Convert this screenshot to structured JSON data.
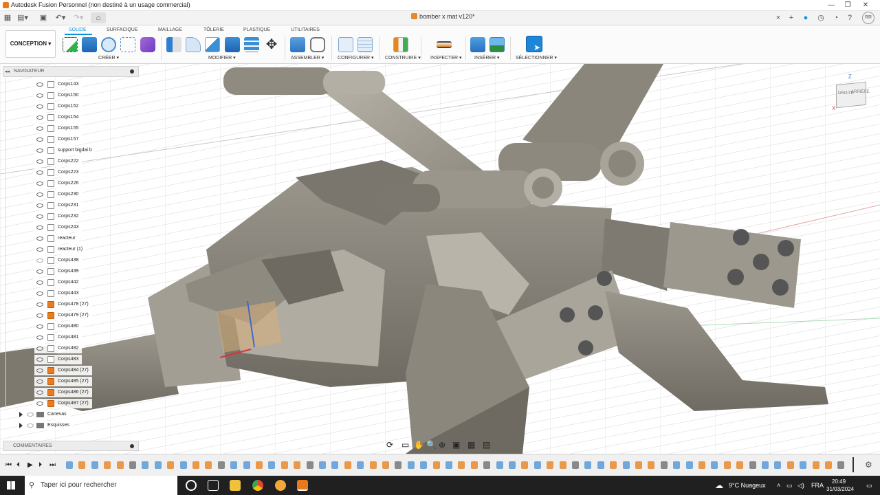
{
  "window": {
    "title": "Autodesk Fusion Personnel (non destiné à un usage commercial)",
    "user_initials": "RR",
    "minimize_glyph": "—",
    "maximize_glyph": "❐",
    "close_glyph": "✕"
  },
  "document": {
    "name": "bomber x mat v120*",
    "close_glyph": "×",
    "plus_glyph": "+"
  },
  "toolbar": {
    "workspace": "CONCEPTION ▾",
    "tabs": [
      "SOLIDE",
      "SURFACIQUE",
      "MAILLAGE",
      "TÔLERIE",
      "PLASTIQUE",
      "UTILITAIRES"
    ],
    "active_tab": "SOLIDE",
    "groups": [
      "CRÉER ▾",
      "MODIFIER ▾",
      "ASSEMBLER ▾",
      "CONFIGURER ▾",
      "CONSTRUIRE ▾",
      "INSPECTER ▾",
      "INSÉRER ▾",
      "SÉLECTIONNER ▾"
    ]
  },
  "navigator": {
    "title": "NAVIGATEUR",
    "collapse_glyph": "◂◂",
    "items": [
      {
        "label": "Corps143",
        "type": "body",
        "visible": true
      },
      {
        "label": "Corps150",
        "type": "body",
        "visible": true
      },
      {
        "label": "Corps152",
        "type": "body",
        "visible": true
      },
      {
        "label": "Corps154",
        "type": "body",
        "visible": true
      },
      {
        "label": "Corps155",
        "type": "body",
        "visible": true
      },
      {
        "label": "Corps157",
        "type": "body",
        "visible": true
      },
      {
        "label": "support bigdai b",
        "type": "body",
        "visible": true
      },
      {
        "label": "Corps222",
        "type": "body",
        "visible": true
      },
      {
        "label": "Corps223",
        "type": "body",
        "visible": true
      },
      {
        "label": "Corps226",
        "type": "body",
        "visible": true
      },
      {
        "label": "Corps230",
        "type": "body",
        "visible": true
      },
      {
        "label": "Corps231",
        "type": "body",
        "visible": true
      },
      {
        "label": "Corps232",
        "type": "body",
        "visible": true
      },
      {
        "label": "Corps243",
        "type": "body",
        "visible": true
      },
      {
        "label": "reacteur",
        "type": "body",
        "visible": true
      },
      {
        "label": "reacteur (1)",
        "type": "body",
        "visible": true
      },
      {
        "label": "Corps438",
        "type": "body",
        "visible": false
      },
      {
        "label": "Corps439",
        "type": "body",
        "visible": true
      },
      {
        "label": "Corps442",
        "type": "body",
        "visible": true
      },
      {
        "label": "Corps443",
        "type": "body",
        "visible": true
      },
      {
        "label": "Corps478 (27)",
        "type": "component",
        "visible": true
      },
      {
        "label": "Corps479 (27)",
        "type": "component",
        "visible": true
      },
      {
        "label": "Corps480",
        "type": "body",
        "visible": true
      },
      {
        "label": "Corps481",
        "type": "body",
        "visible": true
      },
      {
        "label": "Corps482",
        "type": "body",
        "visible": true
      },
      {
        "label": "Corps483",
        "type": "body",
        "visible": true
      },
      {
        "label": "Corps484 (27)",
        "type": "component",
        "visible": true
      },
      {
        "label": "Corps485 (27)",
        "type": "component",
        "visible": true
      },
      {
        "label": "Corps486 (27)",
        "type": "component",
        "visible": true
      },
      {
        "label": "Corps487 (27)",
        "type": "component",
        "visible": true
      }
    ],
    "folders": [
      {
        "label": "Canevas"
      },
      {
        "label": "Esquisses"
      }
    ]
  },
  "comments": {
    "title": "COMMENTAIRES"
  },
  "viewcube": {
    "front": "DROITE",
    "back": "ARRIÈRE",
    "axis_z": "Z",
    "axis_x": "X"
  },
  "taskbar": {
    "search_placeholder": "Taper ici pour rechercher",
    "weather": "9°C Nuageux",
    "language": "FRA",
    "time": "20:49",
    "date": "31/03/2024"
  },
  "colors": {
    "accent": "#0696d7",
    "component": "#e87c1f",
    "model": "#8a857b"
  }
}
